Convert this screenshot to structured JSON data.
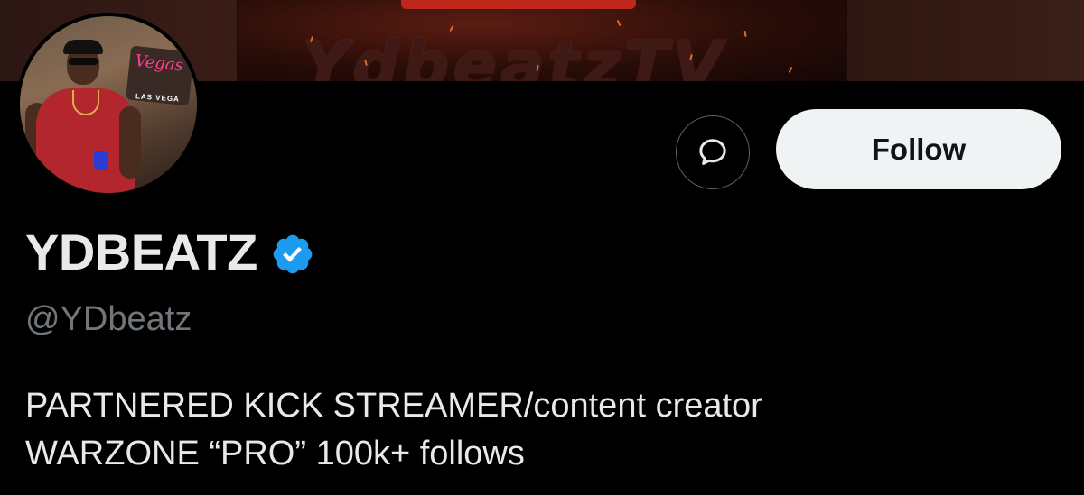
{
  "banner": {
    "art_text": "YdbeatzTV"
  },
  "avatar": {
    "sign_neon": "Vegas",
    "sign_text": "LAS VEGA"
  },
  "actions": {
    "message_icon": "message-bubble-icon",
    "follow_label": "Follow"
  },
  "profile": {
    "display_name": "YDBEATZ",
    "verified_icon": "verified-badge-icon",
    "verified_color": "#1d9bf0",
    "handle": "@YDbeatz",
    "bio_lines": [
      "PARTNERED KICK STREAMER/content creator",
      "WARZONE “PRO” 100k+ follows"
    ]
  },
  "colors": {
    "background": "#000000",
    "primary_text": "#e7e9ea",
    "secondary_text": "#71767b",
    "follow_bg": "#eff3f4"
  }
}
